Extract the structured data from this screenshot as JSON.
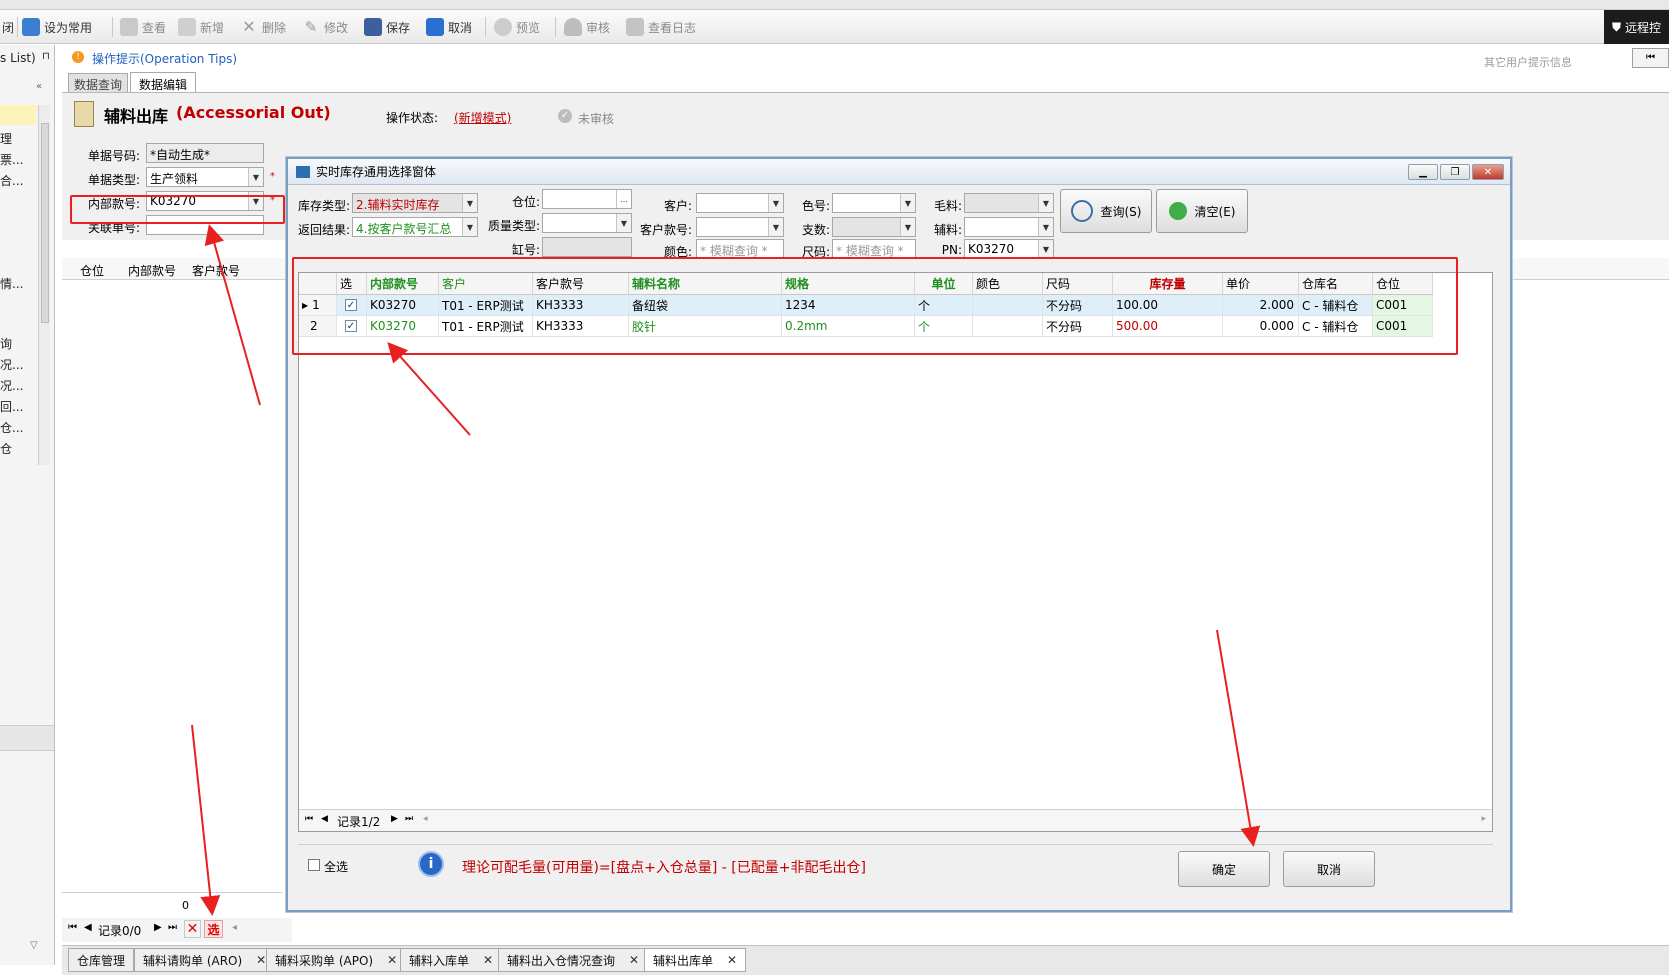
{
  "toolbar": {
    "close_label": "闭",
    "set_common_label": "设为常用",
    "view_label": "查看",
    "new_label": "新增",
    "delete_label": "删除",
    "edit_label": "修改",
    "save_label": "保存",
    "cancel_label": "取消",
    "preview_label": "预览",
    "audit_label": "审核",
    "log_label": "查看日志",
    "remote_label": "远程控"
  },
  "leftnav": {
    "header": "s List)",
    "items": [
      "理",
      "票...",
      "合...",
      "情...",
      "询",
      "况...",
      "况...",
      "回...",
      "仓...",
      "仓"
    ]
  },
  "tips": {
    "label": "操作提示(Operation Tips)",
    "other_user": "其它用户提示信息"
  },
  "tabs": {
    "query": "数据查询",
    "edit": "数据编辑"
  },
  "form": {
    "title_cn": "辅料出库",
    "title_en": "(Accessorial Out)",
    "status_label": "操作状态:",
    "status_value": "(新增模式)",
    "audit_state": "未审核",
    "doc_no_label": "单据号码:",
    "doc_no_value": "*自动生成*",
    "doc_type_label": "单据类型:",
    "doc_type_value": "生产领料",
    "inner_no_label": "内部款号:",
    "inner_no_value": "K03270",
    "link_no_label": "关联单号:",
    "star": "*"
  },
  "main_grid_headers": [
    "仓位",
    "内部款号",
    "客户款号"
  ],
  "bottom_pager": {
    "zero": "0",
    "record": "记录0/0",
    "select": "选"
  },
  "bottom_tabs": [
    {
      "label": "仓库管理",
      "closable": false
    },
    {
      "label": "辅料请购单 (ARO)",
      "closable": true
    },
    {
      "label": "辅料采购单 (APO)",
      "closable": true
    },
    {
      "label": "辅料入库单",
      "closable": true
    },
    {
      "label": "辅料出入仓情况查询",
      "closable": true
    },
    {
      "label": "辅料出库单",
      "closable": true
    }
  ],
  "dialog": {
    "title": "实时库存通用选择窗体",
    "stock_type_label": "库存类型:",
    "stock_type_value": "2.辅料实时库存",
    "return_label": "返回结果:",
    "return_value": "4.按客户款号汇总",
    "location_label": "仓位:",
    "quality_label": "质量类型:",
    "vat_label": "缸号:",
    "customer_label": "客户:",
    "cust_style_label": "客户款号:",
    "color_label": "颜色:",
    "color_placeholder": "* 模糊查询 *",
    "color_no_label": "色号:",
    "count_label": "支数:",
    "size_label": "尺码:",
    "size_placeholder": "* 模糊查询 *",
    "fabric_label": "毛料:",
    "accessory_label": "辅料:",
    "pn_label": "PN:",
    "pn_value": "K03270",
    "query_btn": "查询(S)",
    "clear_btn": "清空(E)",
    "select_all": "全选",
    "formula": "理论可配毛量(可用量)=[盘点+入仓总量] - [已配量+非配毛出仓]",
    "ok_btn": "确定",
    "cancel_btn": "取消",
    "pager_record": "记录1/2",
    "columns": [
      "选",
      "内部款号",
      "客户",
      "客户款号",
      "辅料名称",
      "规格",
      "单位",
      "颜色",
      "尺码",
      "库存量",
      "单价",
      "仓库名",
      "仓位"
    ],
    "rows": [
      {
        "idx": "1",
        "checked": true,
        "inner": "K03270",
        "customer": "T01 - ERP测试",
        "cust_style": "KH3333",
        "name": "备纽袋",
        "spec": "1234",
        "unit": "个",
        "color": "",
        "size": "不分码",
        "stock": "100.00",
        "price": "2.000",
        "warehouse": "C - 辅料仓",
        "loc": "C001"
      },
      {
        "idx": "2",
        "checked": true,
        "inner": "K03270",
        "customer": "T01 - ERP测试",
        "cust_style": "KH3333",
        "name": "胶针",
        "spec": "0.2mm",
        "unit": "个",
        "color": "",
        "size": "不分码",
        "stock": "500.00",
        "price": "0.000",
        "warehouse": "C - 辅料仓",
        "loc": "C001"
      }
    ]
  },
  "colors": {
    "accent_red": "#c00000",
    "green": "#1f8f1f",
    "annot_red": "#e82020"
  }
}
